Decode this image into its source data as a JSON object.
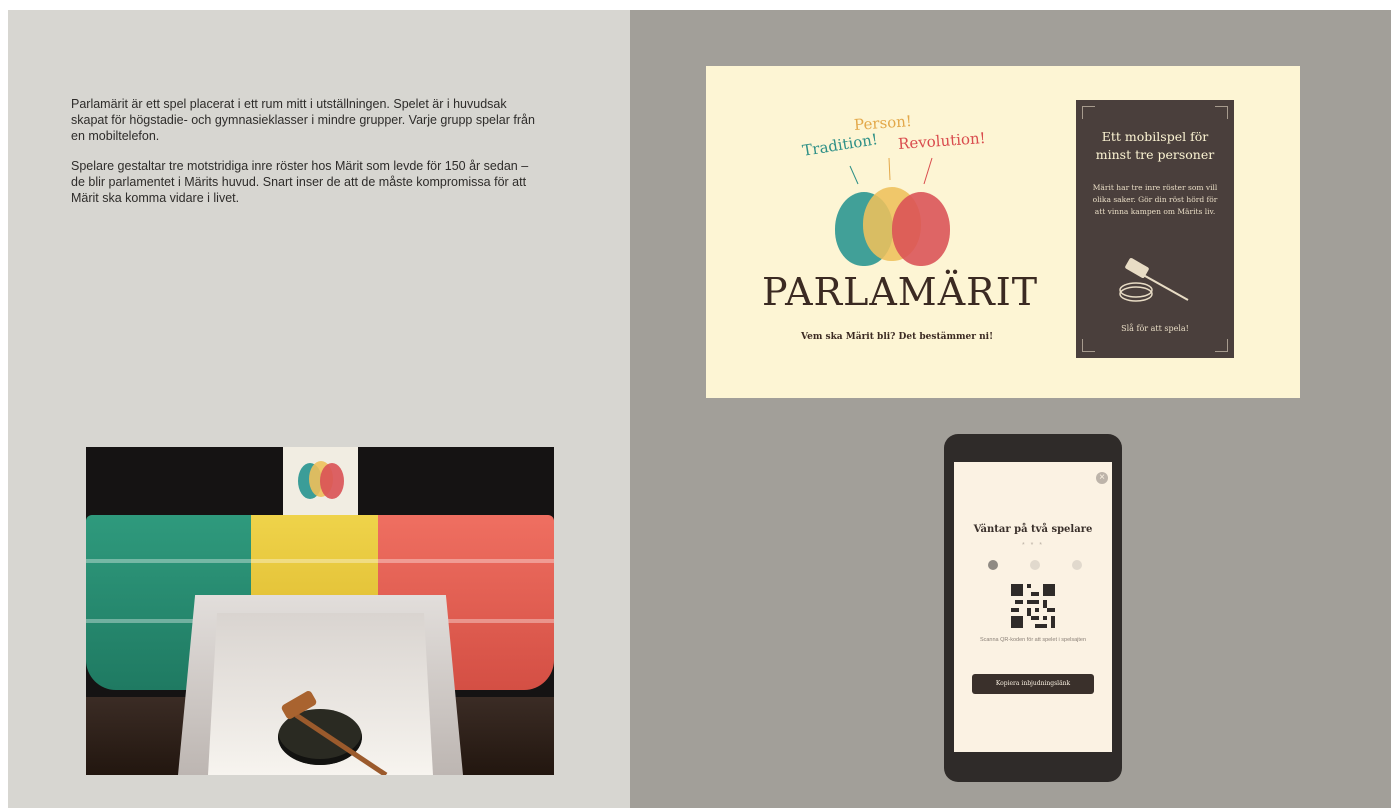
{
  "intro": {
    "paragraph1": "Parlamärit är ett spel placerat i ett rum mitt i utställningen. Spelet är i huvudsak skapat för högstadie- och gymnasieklasser i mindre grupper. Varje grupp spelar från en mobiltelefon.",
    "paragraph2": "Spelare gestaltar tre motstridiga inre röster hos Märit som levde för 150 år sedan – de blir parlamentet i Märits huvud. Snart inser de att de måste kompromissa för att Märit ska komma vidare i livet."
  },
  "poster": {
    "word_tradition": "Tradition!",
    "word_person": "Person!",
    "word_revolution": "Revolution!",
    "title": "PARLAMÄRIT",
    "subtitle": "Vem ska Märit bli? Det bestämmer ni!",
    "card_title": "Ett mobilspel för minst tre personer",
    "card_text": "Märit har tre inre röster som vill olika saker. Gör din röst hörd för att vinna kampen om Märits liv.",
    "card_cta": "Slå för att spela!"
  },
  "phone": {
    "close": "×",
    "waiting": "Väntar på två spelare",
    "stars": "* * *",
    "qr_note": "Scanna QR-koden för att spelet i spelsajten",
    "copy_button": "Kopiera inbjudningslänk"
  },
  "colors": {
    "tradition": "#2c8f86",
    "person": "#e3a84a",
    "revolution": "#d94b4d",
    "dark_brown": "#3b2a22"
  }
}
